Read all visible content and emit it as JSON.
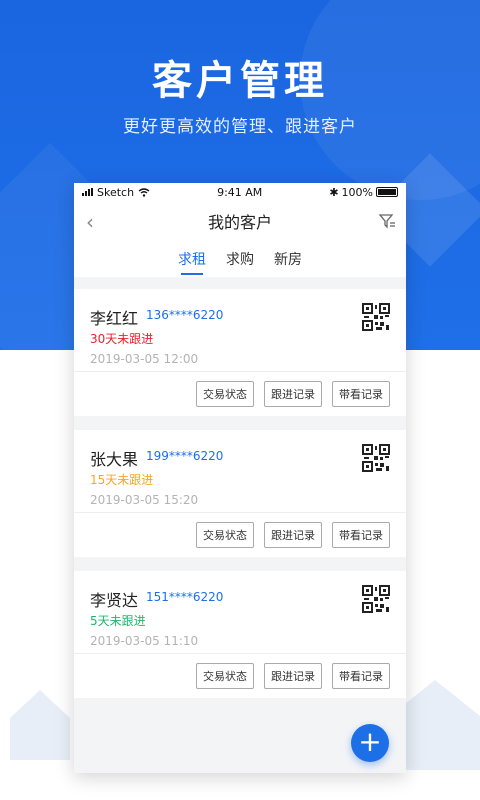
{
  "promo": {
    "title": "客户管理",
    "subtitle": "更好更高效的管理、跟进客户"
  },
  "statusbar": {
    "carrier": "Sketch",
    "time": "9:41 AM",
    "battery": "100%"
  },
  "navbar": {
    "title": "我的客户",
    "back_icon": "chevron-left-icon",
    "filter_icon": "filter-icon"
  },
  "tabs": [
    {
      "label": "求租",
      "active": true
    },
    {
      "label": "求购",
      "active": false
    },
    {
      "label": "新房",
      "active": false
    }
  ],
  "customers": [
    {
      "name": "李红红",
      "phone": "136****6220",
      "follow": "30天未跟进",
      "follow_color": "#e8212d",
      "date": "2019-03-05 12:00"
    },
    {
      "name": "张大果",
      "phone": "199****6220",
      "follow": "15天未跟进",
      "follow_color": "#f5a623",
      "date": "2019-03-05 15:20"
    },
    {
      "name": "李贤达",
      "phone": "151****6220",
      "follow": "5天未跟进",
      "follow_color": "#27b36a",
      "date": "2019-03-05 11:10"
    }
  ],
  "actions": {
    "status": "交易状态",
    "follow_record": "跟进记录",
    "view_record": "带看记录"
  },
  "fab_label": "+",
  "colors": {
    "accent": "#1d6fe8",
    "background_blue": "#1f6fe8"
  }
}
